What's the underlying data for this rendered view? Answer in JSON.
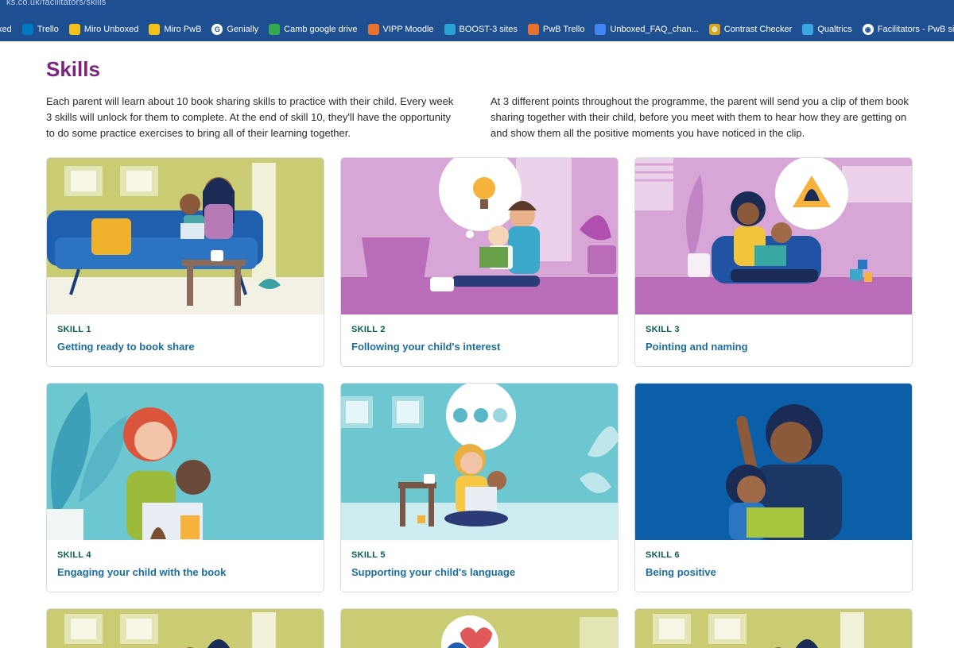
{
  "browser": {
    "url_fragment": "ks.co.uk/facilitators/skills",
    "bookmarks": [
      {
        "label": "xed",
        "icon": "none",
        "color": "#1d4f91"
      },
      {
        "label": "Trello",
        "icon": "trello-icon",
        "color": "#0079bf"
      },
      {
        "label": "Miro Unboxed",
        "icon": "miro-icon",
        "color": "#f2c218"
      },
      {
        "label": "Miro PwB",
        "icon": "miro-icon",
        "color": "#f2c218"
      },
      {
        "label": "Genially",
        "icon": "genially-icon",
        "color": "#ffffff"
      },
      {
        "label": "Camb google drive",
        "icon": "drive-icon",
        "color": "#34a853"
      },
      {
        "label": "VIPP Moodle",
        "icon": "moodle-icon",
        "color": "#e8712d"
      },
      {
        "label": "BOOST-3 sites",
        "icon": "sites-icon",
        "color": "#29a3d6"
      },
      {
        "label": "PwB Trello",
        "icon": "trello-icon",
        "color": "#e8712d"
      },
      {
        "label": "Unboxed_FAQ_chan...",
        "icon": "doc-icon",
        "color": "#4285f4"
      },
      {
        "label": "Contrast Checker",
        "icon": "gear-icon",
        "color": "#d9a520"
      },
      {
        "label": "Qualtrics",
        "icon": "qualtrics-icon",
        "color": "#3aa6e0"
      },
      {
        "label": "Facilitators - PwB site",
        "icon": "globe-icon",
        "color": "#ffffff"
      }
    ]
  },
  "page": {
    "title": "Skills",
    "intro_left": "Each parent will learn about 10 book sharing skills to practice with their child. Every week 3 skills will unlock for them to complete. At the end of skill 10, they'll have the opportunity to do some practice exercises to bring all of their learning together.",
    "intro_right": "At 3 different points throughout the programme, the parent will send you a clip of them book sharing together with their child, before you meet with them to hear how they are getting on and show them all the positive moments you have noticed in the clip."
  },
  "skills": [
    {
      "kicker": "SKILL 1",
      "title": "Getting ready to book share",
      "bg": "#c9cc72"
    },
    {
      "kicker": "SKILL 2",
      "title": "Following your child's interest",
      "bg": "#d7a6d6"
    },
    {
      "kicker": "SKILL 3",
      "title": "Pointing and naming",
      "bg": "#d7a6d6"
    },
    {
      "kicker": "SKILL 4",
      "title": "Engaging your child with the book",
      "bg": "#6cc7d1"
    },
    {
      "kicker": "SKILL 5",
      "title": "Supporting your child's language",
      "bg": "#6cc7d1"
    },
    {
      "kicker": "SKILL 6",
      "title": "Being positive",
      "bg": "#0b5ea8"
    }
  ],
  "colors": {
    "title": "#7b2381",
    "kicker": "#0b5b57",
    "card_title": "#1b6e9c",
    "chrome": "#1d4f91"
  }
}
